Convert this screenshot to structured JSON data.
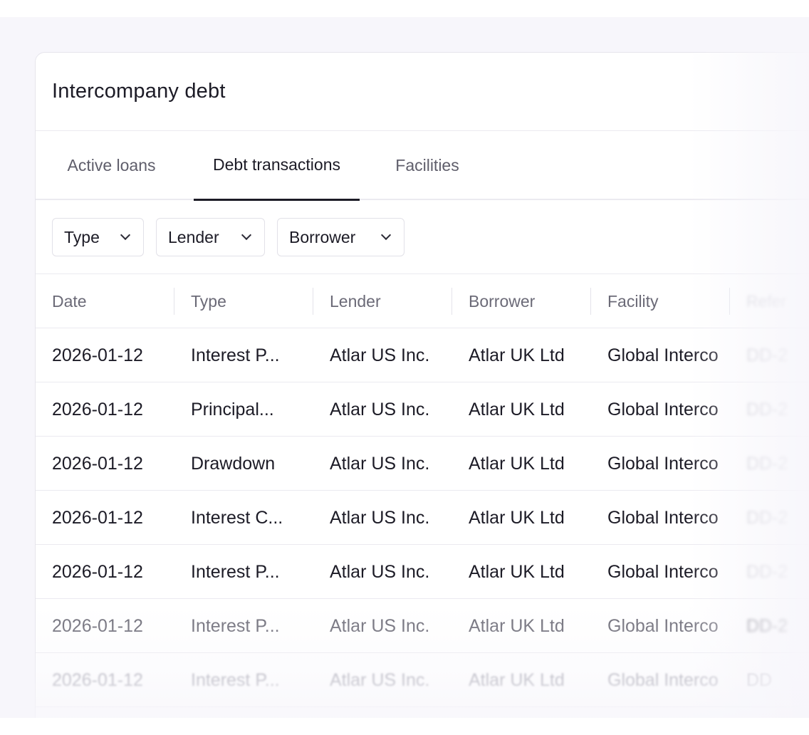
{
  "card": {
    "title": "Intercompany debt"
  },
  "tabs": [
    {
      "label": "Active loans",
      "active": false
    },
    {
      "label": "Debt transactions",
      "active": true
    },
    {
      "label": "Facilities",
      "active": false
    }
  ],
  "filters": [
    {
      "label": "Type",
      "icon": "chevron-down-icon"
    },
    {
      "label": "Lender",
      "icon": "chevron-down-icon"
    },
    {
      "label": "Borrower",
      "icon": "chevron-down-icon"
    }
  ],
  "table": {
    "columns": [
      "Date",
      "Type",
      "Lender",
      "Borrower",
      "Facility",
      "Refer"
    ],
    "rows": [
      [
        "2026-01-12",
        "Interest P...",
        "Atlar US Inc.",
        "Atlar UK Ltd",
        "Global Interco",
        "DD-2"
      ],
      [
        "2026-01-12",
        "Principal...",
        "Atlar US Inc.",
        "Atlar UK Ltd",
        "Global Interco",
        "DD-2"
      ],
      [
        "2026-01-12",
        "Drawdown",
        "Atlar US Inc.",
        "Atlar UK Ltd",
        "Global Interco",
        "DD-2"
      ],
      [
        "2026-01-12",
        "Interest C...",
        "Atlar US Inc.",
        "Atlar UK Ltd",
        "Global Interco",
        "DD-2"
      ],
      [
        "2026-01-12",
        "Interest P...",
        "Atlar US Inc.",
        "Atlar UK Ltd",
        "Global Interco",
        "DD-2"
      ],
      [
        "2026-01-12",
        "Interest P...",
        "Atlar US Inc.",
        "Atlar UK Ltd",
        "Global Interco",
        "DD-2"
      ],
      [
        "2026-01-12",
        "Interest P...",
        "Atlar US Inc.",
        "Atlar UK Ltd",
        "Global Interco",
        "DD"
      ]
    ]
  },
  "colors": {
    "text": "#1c1b26",
    "muted": "#6b6a77",
    "border": "#ebeaf0",
    "backdrop": "#f7f6fb"
  }
}
